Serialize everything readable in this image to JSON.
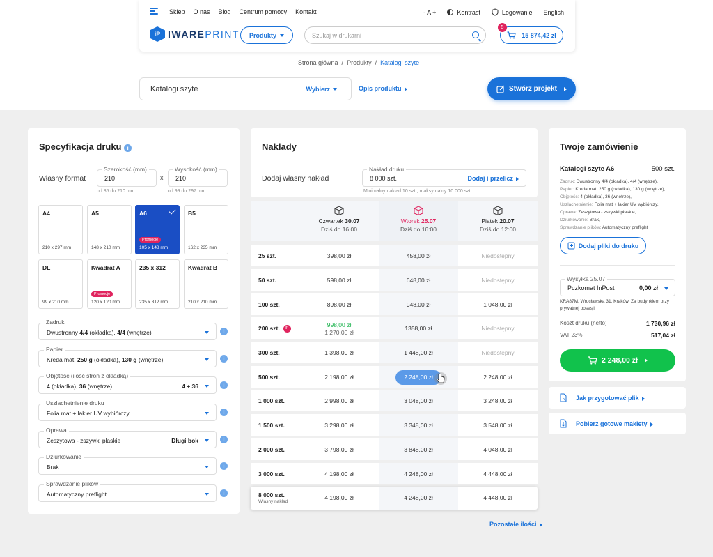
{
  "nav": {
    "items": [
      "Sklep",
      "O nas",
      "Blog",
      "Centrum pomocy",
      "Kontakt"
    ],
    "font_size": "- A +",
    "contrast": "Kontrast",
    "login": "Logowanie",
    "lang": "English"
  },
  "brand": {
    "mark": "iP",
    "name_bold": "IWARE",
    "name_light": "PRINT"
  },
  "products_btn": "Produkty",
  "search": {
    "placeholder": "Szukaj w drukarni"
  },
  "cart": {
    "count": "5",
    "total": "15 874,42 zł"
  },
  "breadcrumb": {
    "home": "Strona główna",
    "products": "Produkty",
    "current": "Katalogi szyte"
  },
  "product": {
    "name": "Katalogi szyte",
    "choose": "Wybierz",
    "desc_link": "Opis produktu",
    "create": "Stwórz projekt"
  },
  "spec": {
    "title": "Specyfikacja druku",
    "custom_format": "Własny format",
    "width_label": "Szerokość (mm)",
    "width_value": "210",
    "width_hint": "od 85 do 210 mm",
    "height_label": "Wysokość (mm)",
    "height_value": "210",
    "height_hint": "od 99 do 297 mm",
    "x": "x",
    "formats": [
      {
        "name": "A4",
        "size": "210 x 297 mm"
      },
      {
        "name": "A5",
        "size": "148 x 210 mm"
      },
      {
        "name": "A6",
        "size": "105 x 148 mm",
        "promo": "Promocje"
      },
      {
        "name": "B5",
        "size": "162 x 235 mm"
      },
      {
        "name": "DL",
        "size": "99 x 210 mm"
      },
      {
        "name": "Kwadrat A",
        "size": "120 x 120 mm",
        "promo": "Promocje"
      },
      {
        "name": "235 x 312",
        "size": "235 x 312 mm"
      },
      {
        "name": "Kwadrat B",
        "size": "210 x 210 mm"
      }
    ],
    "options": [
      {
        "label": "Zadruk",
        "value_parts": [
          "Dwustronny ",
          "4/4",
          " (okładka), ",
          "4/4",
          " (wnętrze)"
        ],
        "right": ""
      },
      {
        "label": "Papier",
        "value_parts": [
          "Kreda mat: ",
          "250 g",
          " (okładka), ",
          "130 g",
          " (wnętrze)"
        ],
        "right": ""
      },
      {
        "label": "Objętość (ilość stron z okładką)",
        "value_parts": [
          "",
          "4",
          " (okładka), ",
          "36",
          " (wnętrze)"
        ],
        "right": "4 + 36"
      },
      {
        "label": "Uszlachetnienie druku",
        "value_parts": [
          "Folia mat + lakier UV wybiórczy",
          "",
          "",
          "",
          ""
        ],
        "right": ""
      },
      {
        "label": "Oprawa",
        "value_parts": [
          "Zeszytowa - zszywki płaskie",
          "",
          "",
          "",
          ""
        ],
        "right": "Długi bok"
      },
      {
        "label": "Dziurkowanie",
        "value_parts": [
          "Brak",
          "",
          "",
          "",
          ""
        ],
        "right": ""
      },
      {
        "label": "Sprawdzanie plików",
        "value_parts": [
          "Automatyczny preflight",
          "",
          "",
          "",
          ""
        ],
        "right": ""
      }
    ]
  },
  "naklady": {
    "title": "Nakłady",
    "custom": "Dodaj własny nakład",
    "input_label": "Nakład druku",
    "input_value": "8 000 szt.",
    "add_btn": "Dodaj i przelicz",
    "hint": "Minimalny nakład 10 szt., maksymalny 10 000 szt.",
    "dates": [
      {
        "day": "Czwartek ",
        "date": "30.07",
        "time": "Dziś do 16:00",
        "color": "#333333"
      },
      {
        "day": "Wtorek ",
        "date": "25.07",
        "time": "Dziś do 16:00",
        "color": "#e0245e"
      },
      {
        "day": "Piątek ",
        "date": "20.07",
        "time": "Dziś do 12:00",
        "color": "#333333"
      }
    ],
    "rows": [
      {
        "q": "25 szt.",
        "c": [
          "398,00 zł",
          "458,00 zł",
          "Niedostępny"
        ]
      },
      {
        "q": "50 szt.",
        "c": [
          "598,00 zł",
          "648,00 zł",
          "Niedostępny"
        ]
      },
      {
        "q": "100 szt.",
        "c": [
          "898,00 zł",
          "948,00 zł",
          "1 048,00 zł"
        ]
      },
      {
        "q": "200 szt.",
        "c": [
          "998,00 zł",
          "1358,00 zł",
          "Niedostępny"
        ],
        "old": "1 270,00 zł",
        "badge": "P"
      },
      {
        "q": "300 szt.",
        "c": [
          "1 398,00 zł",
          "1 448,00 zł",
          "Niedostępny"
        ]
      },
      {
        "q": "500 szt.",
        "c": [
          "2 198,00 zł",
          "2 248,00 zł",
          "2 248,00 zł"
        ]
      },
      {
        "q": "1 000 szt.",
        "c": [
          "2 998,00 zł",
          "3 048,00 zł",
          "3 248,00 zł"
        ]
      },
      {
        "q": "1 500 szt.",
        "c": [
          "3 298,00 zł",
          "3 348,00 zł",
          "3 548,00 zł"
        ]
      },
      {
        "q": "2 000 szt.",
        "c": [
          "3 798,00 zł",
          "3 848,00 zł",
          "4 048,00 zł"
        ]
      },
      {
        "q": "3 000 szt.",
        "c": [
          "4 198,00 zł",
          "4 248,00 zł",
          "4 448,00 zł"
        ]
      },
      {
        "q": "8 000 szt.",
        "c": [
          "4 198,00 zł",
          "4 248,00 zł",
          "4 448,00 zł"
        ],
        "sub": "Własny nakład"
      }
    ],
    "more": "Pozostałe ilości"
  },
  "order": {
    "title": "Twoje zamówienie",
    "product": "Katalogi szyte A6",
    "qty": "500 szt.",
    "details": [
      {
        "k": "Zadruk:",
        "v": " Dwustronny 4/4 (okładka), 4/4 (wnętrze),"
      },
      {
        "k": "Papier:",
        "v": " Kreda mat: 250 g (okładka), 130 g (wnętrze),"
      },
      {
        "k": "Objętość:",
        "v": " 4 (okładka), 36 (wnętrze),"
      },
      {
        "k": "Uszlachetnienie:",
        "v": " Folia mat + lakier UV wybiórczy,"
      },
      {
        "k": "Oprawa:",
        "v": " Zeszytowa - zszywki płaskie,"
      },
      {
        "k": "Dziurkowanie:",
        "v": " Brak,"
      },
      {
        "k": "Sprawdzanie plików:",
        "v": " Automatyczny preflight"
      }
    ],
    "add_files": "Dodaj pliki do druku",
    "shipping_label": "Wysyłka 25.07",
    "shipping_value": "Pczkomat InPost",
    "shipping_price": "0,00 zł",
    "address": "KRA87M, Wrocławska 31, Kraków, Za budynkiem przy prywatnej posesji",
    "cost_label": "Koszt druku (netto)",
    "cost": "1 730,96 zł",
    "vat_label": "VAT 23%",
    "vat": "517,04 zł",
    "total": "2 248,00 zł",
    "link1": "Jak przygotować plik",
    "link2": "Pobierz gotowe makiety"
  }
}
